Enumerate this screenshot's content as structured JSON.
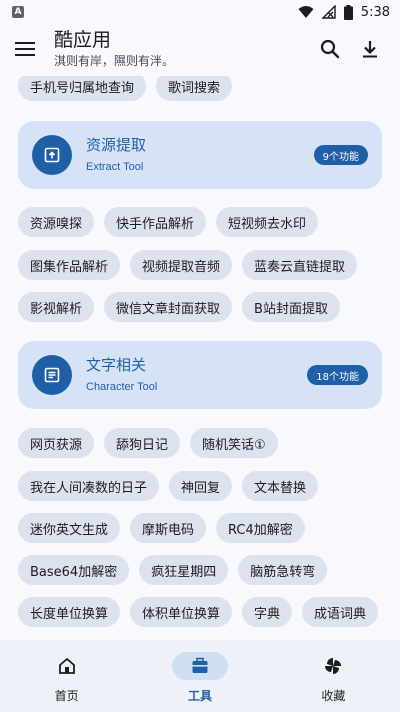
{
  "status_bar": {
    "app_icon_letter": "A",
    "time": "5:38"
  },
  "app_bar": {
    "title": "酷应用",
    "subtitle": "淇则有岸，隰则有泮。"
  },
  "top_chips": [
    "手机号归属地查询",
    "歌词搜索"
  ],
  "sections": [
    {
      "title": "资源提取",
      "subtitle": "Extract Tool",
      "badge": "9个功能",
      "chips": [
        [
          "资源嗅探",
          "快手作品解析",
          "短视频去水印"
        ],
        [
          "图集作品解析",
          "视频提取音频",
          "蓝奏云直链提取"
        ],
        [
          "影视解析",
          "微信文章封面获取",
          "B站封面提取"
        ]
      ]
    },
    {
      "title": "文字相关",
      "subtitle": "Character Tool",
      "badge": "18个功能",
      "chips": [
        [
          "网页获源",
          "舔狗日记",
          "随机笑话①"
        ],
        [
          "我在人间凑数的日子",
          "神回复",
          "文本替换"
        ],
        [
          "迷你英文生成",
          "摩斯电码",
          "RC4加解密"
        ],
        [
          "Base64加解密",
          "疯狂星期四",
          "脑筋急转弯"
        ],
        [
          "长度单位换算",
          "体积单位换算",
          "字典",
          "成语词典"
        ]
      ]
    }
  ],
  "bottom_nav": [
    {
      "label": "首页",
      "icon": "home-icon"
    },
    {
      "label": "工具",
      "icon": "toolbox-icon"
    },
    {
      "label": "收藏",
      "icon": "pinwheel-icon"
    }
  ],
  "colors": {
    "primary": "#1f5fa8",
    "card_bg": "#d6e3f7",
    "chip_bg": "#dde3ee",
    "background": "#f7f9ff"
  }
}
